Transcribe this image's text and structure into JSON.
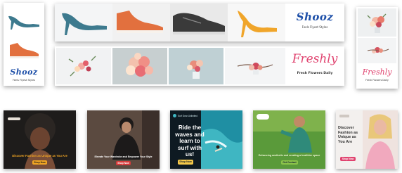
{
  "brands": {
    "shooz": {
      "logo": "Shooz",
      "tagline": "Feels Flyest Styles"
    },
    "freshly": {
      "logo": "Freshly",
      "tagline": "Fresh Flowers Daily"
    }
  },
  "colors": {
    "shooz_blue": "#1d4fa8",
    "freshly_pink": "#e0436f",
    "ad_button_orange": "#f2a623",
    "ad_button_red": "#d63b3b",
    "ad_button_green": "#8bc34a",
    "ad_button_yellow": "#f6c94a"
  },
  "ads": [
    {
      "headline": "Discover Fashion as Unique as You Are",
      "button": "Shop Now"
    },
    {
      "headline": "Elevate Your Wardrobe and Empower Your Style",
      "button": "Shop Now"
    },
    {
      "badge": "Surf Gear Unlimited",
      "headline": "Ride the waves and learn to surf with us!",
      "button": "Shop Now"
    },
    {
      "headline": "Enhancing aesthetic and creating a healthier space",
      "button": "Get Contact"
    },
    {
      "headline": "Discover Fashion as Unique as You Are",
      "button": "Shop Now"
    }
  ]
}
